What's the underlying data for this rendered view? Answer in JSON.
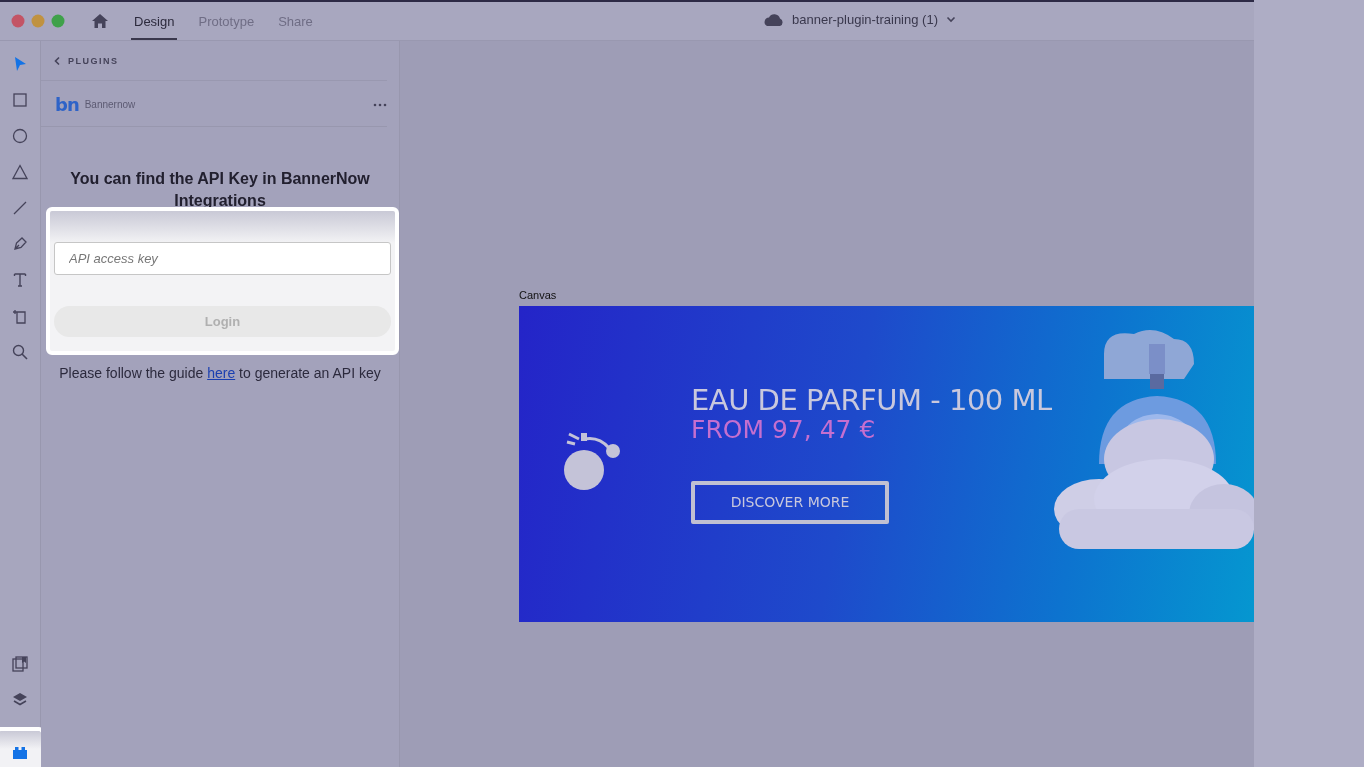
{
  "window": {
    "tabs": [
      {
        "label": "Design",
        "selected": true
      },
      {
        "label": "Prototype",
        "selected": false
      },
      {
        "label": "Share",
        "selected": false
      }
    ],
    "document_title": "banner-plugin-training (1)"
  },
  "tools": [
    {
      "kind": "select",
      "selected": true
    },
    {
      "kind": "rectangle",
      "selected": false
    },
    {
      "kind": "ellipse",
      "selected": false
    },
    {
      "kind": "polygon",
      "selected": false
    },
    {
      "kind": "line",
      "selected": false
    },
    {
      "kind": "pen",
      "selected": false
    },
    {
      "kind": "text",
      "selected": false
    },
    {
      "kind": "artboard",
      "selected": false
    },
    {
      "kind": "zoom",
      "selected": false
    }
  ],
  "bottom_tools": [
    {
      "kind": "assets",
      "selected": false
    },
    {
      "kind": "layers",
      "selected": false
    },
    {
      "kind": "plugins",
      "selected": true
    }
  ],
  "plugin_panel": {
    "back_label": "PLUGINS",
    "logo": "bn",
    "plugin_name": "Bannernow",
    "heading": "You can find the API Key in BannerNow Integrations",
    "api_key_field": {
      "placeholder": "API access key"
    },
    "login_button": {
      "label": "Login",
      "disabled": true
    },
    "guide": {
      "before": "Please follow the guide",
      "link": "here",
      "after": "to generate an API key"
    }
  },
  "canvas": {
    "artboard_label": "Canvas",
    "banner": {
      "title": "EAU DE PARFUM - 100 ML",
      "price": "FROM 97, 47 €",
      "button": "DISCOVER MORE"
    }
  }
}
